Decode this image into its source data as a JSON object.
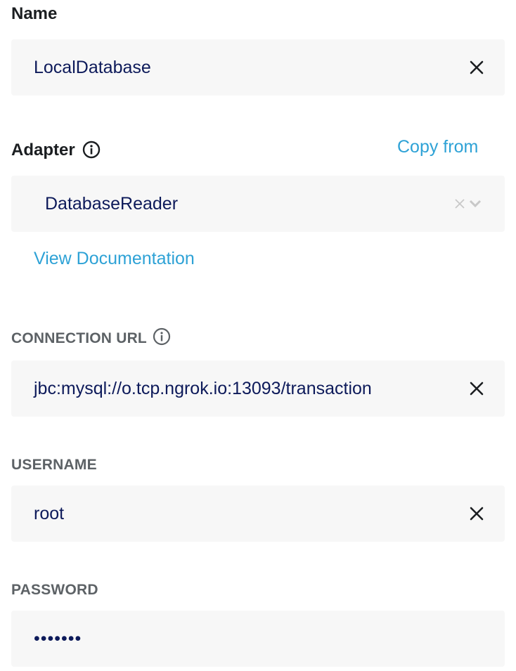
{
  "name_field": {
    "label": "Name",
    "value": "LocalDatabase",
    "clear_icon": "close-icon"
  },
  "adapter_field": {
    "label": "Adapter",
    "info_icon": "info-circle-icon",
    "copy_from_label": "Copy from",
    "selected_value": "DatabaseReader",
    "clear_icon": "close-icon",
    "dropdown_icon": "chevron-down-icon",
    "docs_link": "View Documentation"
  },
  "connection_url_field": {
    "label": "CONNECTION URL",
    "info_icon": "info-circle-icon",
    "value": "jbc:mysql://o.tcp.ngrok.io:13093/transaction",
    "clear_icon": "close-icon"
  },
  "username_field": {
    "label": "USERNAME",
    "value": "root",
    "clear_icon": "close-icon"
  },
  "password_field": {
    "label": "PASSWORD",
    "masked_value": "•••••••"
  },
  "colors": {
    "link": "#2ea2d6",
    "value_text": "#0d1a5a",
    "field_bg": "#f7f7f7"
  }
}
